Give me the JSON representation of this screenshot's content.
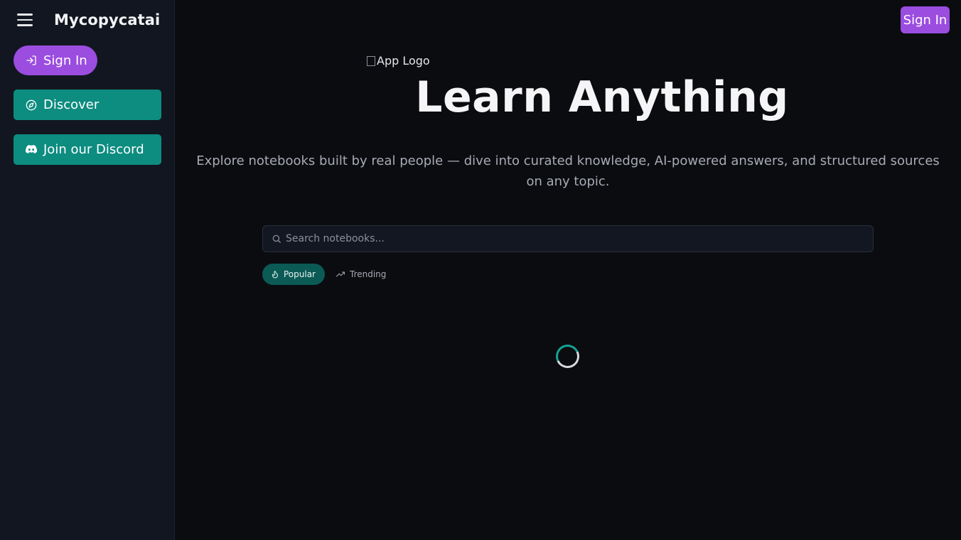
{
  "sidebar": {
    "app_name": "Mycopycatai",
    "signin_label": "Sign In",
    "items": [
      {
        "label": "Discover",
        "icon": "compass-icon"
      },
      {
        "label": "Join our Discord",
        "icon": "discord-icon"
      }
    ]
  },
  "header": {
    "signin_label": "Sign In"
  },
  "hero": {
    "logo_alt": "App Logo",
    "title": "Learn Anything",
    "subtitle": "Explore notebooks built by real people — dive into curated knowledge, AI-powered answers, and structured sources on any topic."
  },
  "search": {
    "placeholder": "Search notebooks..."
  },
  "filters": [
    {
      "label": "Popular",
      "icon": "flame-icon",
      "active": true
    },
    {
      "label": "Trending",
      "icon": "trending-up-icon",
      "active": false
    }
  ],
  "colors": {
    "accent_purple": "#9b4de0",
    "accent_teal": "#0d8c80",
    "background": "#0b0c10",
    "sidebar": "#121620"
  }
}
